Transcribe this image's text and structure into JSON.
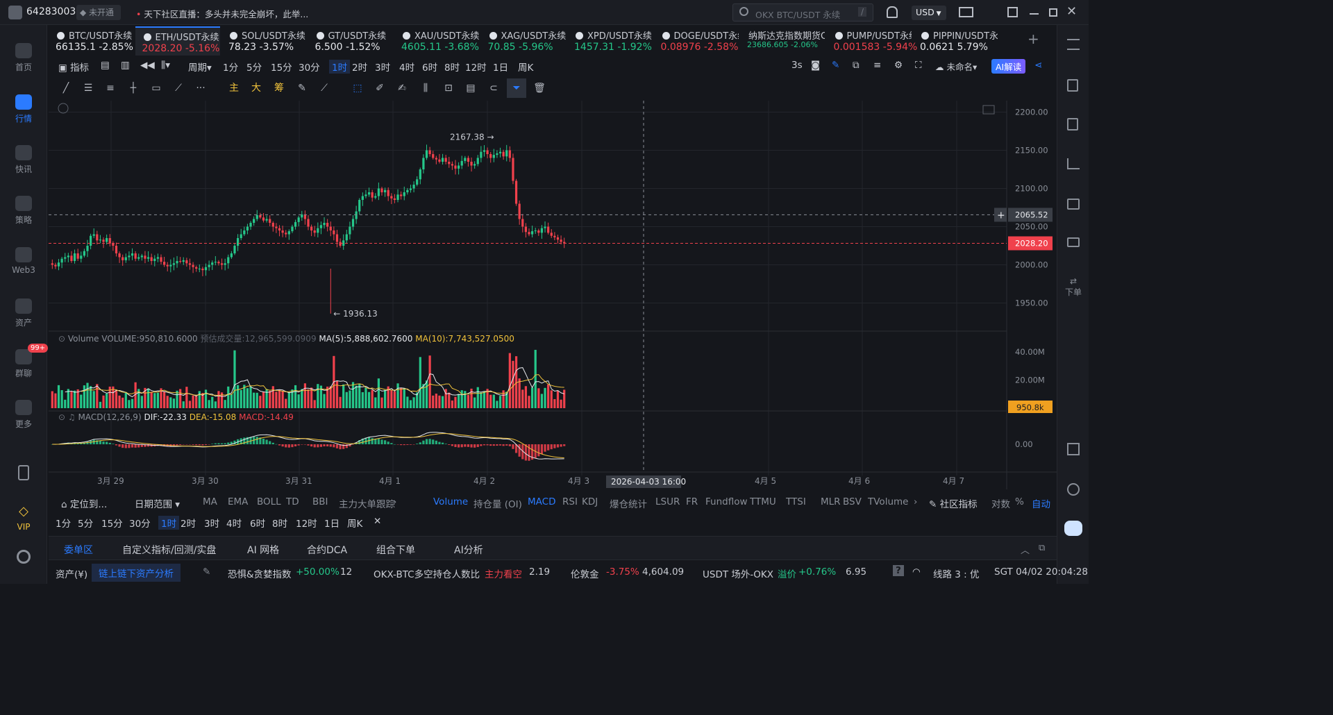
{
  "topbar": {
    "user_id": "64283003",
    "market_status": "未开通",
    "news": "天下社区直播：多头并未完全崩坏，此举...",
    "search_placeholder": "OKX BTC/USDT 永续",
    "search_shortcut": "/",
    "currency": "USD"
  },
  "nav": [
    {
      "label": "首页",
      "icon": "home-icon"
    },
    {
      "label": "行情",
      "icon": "market-icon",
      "active": true
    },
    {
      "label": "快讯",
      "icon": "news-icon"
    },
    {
      "label": "策略",
      "icon": "robot-icon"
    },
    {
      "label": "Web3",
      "icon": "web3-icon"
    },
    {
      "label": "资产",
      "icon": "wallet-icon"
    },
    {
      "label": "群聊",
      "icon": "chat-icon",
      "badge": "99+"
    },
    {
      "label": "更多",
      "icon": "grid-icon"
    },
    {
      "label": "",
      "icon": "phone-icon"
    },
    {
      "label": "VIP",
      "icon": "vip-icon"
    },
    {
      "label": "",
      "icon": "settings-icon"
    }
  ],
  "tickers": [
    {
      "name": "BTC/USDT永续",
      "price": "66135.1",
      "change": "-2.85%",
      "dir": "white"
    },
    {
      "name": "ETH/USDT永续",
      "price": "2028.20",
      "change": "-5.16%",
      "dir": "down",
      "active": true
    },
    {
      "name": "SOL/USDT永续",
      "price": "78.23",
      "change": "-3.57%",
      "dir": "white"
    },
    {
      "name": "GT/USDT永续",
      "price": "6.500",
      "change": "-1.52%",
      "dir": "white"
    },
    {
      "name": "XAU/USDT永续",
      "price": "4605.11",
      "change": "-3.68%",
      "dir": "up"
    },
    {
      "name": "XAG/USDT永续",
      "price": "70.85",
      "change": "-5.96%",
      "dir": "up"
    },
    {
      "name": "XPD/USDT永续",
      "price": "1457.31",
      "change": "-1.92%",
      "dir": "up"
    },
    {
      "name": "DOGE/USDT永续",
      "price": "0.08976",
      "change": "-2.58%",
      "dir": "down"
    },
    {
      "name": "纳斯达克指数期货C",
      "price": "23686.605",
      "change": "-2.06%",
      "dir": "up",
      "small": true
    },
    {
      "name": "PUMP/USDT永续",
      "price": "0.001583",
      "change": "-5.94%",
      "dir": "down"
    },
    {
      "name": "PIPPIN/USDT永续",
      "price": "0.0621",
      "change": "5.79%",
      "dir": "white"
    }
  ],
  "periodbar": {
    "indicator": "指标",
    "period": "周期",
    "periods": [
      "1分",
      "5分",
      "15分",
      "30分",
      "1时",
      "2时",
      "3时",
      "4时",
      "6时",
      "8时",
      "12时",
      "1日",
      "周K"
    ],
    "selected": "1时",
    "refresh": "3s",
    "unnamed": "未命名",
    "ai": "AI解读"
  },
  "toolbar_labels": [
    "主",
    "大",
    "筹"
  ],
  "chart_data": {
    "type": "candlestick",
    "symbol": "ETH/USDT永续",
    "interval": "1时",
    "y_ticks": [
      "2200.00",
      "2150.00",
      "2100.00",
      "2050.00",
      "2000.00",
      "1950.00"
    ],
    "ylim": [
      1915,
      2215
    ],
    "x_ticks": [
      "3月 29",
      "3月 30",
      "3月 31",
      "4月 1",
      "4月 2",
      "4月 3",
      "4月 5",
      "4月 6",
      "4月 7"
    ],
    "high_label": "2167.38",
    "low_label": "1936.13",
    "last_price": "2028.20",
    "crosshair_price": "2065.52",
    "crosshair_time": "2026-04-03 16:00",
    "close_series": [
      2000,
      1998,
      2003,
      2008,
      2010,
      2012,
      2005,
      2015,
      2008,
      2012,
      2018,
      2025,
      2038,
      2040,
      2032,
      2033,
      2030,
      2035,
      2028,
      2025,
      2015,
      2010,
      2006,
      2010,
      2012,
      2015,
      2008,
      2010,
      2012,
      2008,
      2010,
      2005,
      2008,
      2010,
      2004,
      2000,
      1998,
      2000,
      2002,
      2005,
      2004,
      2006,
      2002,
      2000,
      1997,
      1995,
      1995,
      1993,
      1997,
      2000,
      2003,
      2004,
      2002,
      2000,
      2002,
      2010,
      2015,
      2025,
      2035,
      2040,
      2045,
      2050,
      2055,
      2060,
      2065,
      2062,
      2058,
      2060,
      2055,
      2050,
      2048,
      2045,
      2042,
      2040,
      2044,
      2050,
      2056,
      2062,
      2066,
      2060,
      2050,
      2045,
      2042,
      2048,
      2052,
      2055,
      2050,
      2045,
      2040,
      2030,
      2025,
      2032,
      2040,
      2050,
      2060,
      2070,
      2085,
      2090,
      2092,
      2095,
      2088,
      2090,
      2100,
      2095,
      2098,
      2090,
      2087,
      2085,
      2092,
      2090,
      2095,
      2098,
      2100,
      2105,
      2112,
      2125,
      2140,
      2150,
      2145,
      2140,
      2138,
      2135,
      2140,
      2135,
      2132,
      2130,
      2126,
      2130,
      2136,
      2140,
      2135,
      2130,
      2132,
      2140,
      2148,
      2150,
      2145,
      2140,
      2144,
      2146,
      2148,
      2142,
      2150,
      2140,
      2110,
      2080,
      2060,
      2050,
      2043,
      2040,
      2044,
      2045,
      2042,
      2048,
      2050,
      2042,
      2038,
      2036,
      2033,
      2030,
      2028
    ],
    "volume": {
      "label": "Volume",
      "volume_value": "VOLUME:950,810.6000",
      "estimated": "预估成交量:12,965,599.0909",
      "ma5": "MA(5):5,888,602.7600",
      "ma10": "MA(10):7,743,527.0500",
      "y_ticks": [
        "40.00M",
        "20.00M"
      ],
      "last": "950.8k"
    },
    "macd": {
      "label": "MACD(12,26,9)",
      "dif": "DIF:-22.33",
      "dea": "DEA:-15.08",
      "macd": "MACD:-14.49",
      "y_ticks": [
        "0.00"
      ]
    }
  },
  "indicator_row": {
    "locate": "定位到...",
    "date_range": "日期范围",
    "main": [
      "MA",
      "EMA",
      "BOLL",
      "TD",
      "BBI",
      "主力大单跟踪"
    ],
    "sub": [
      "Volume",
      "持仓量 (OI)",
      "MACD",
      "RSI",
      "KDJ",
      "爆仓统计",
      "LSUR",
      "FR",
      "Fundflow",
      "TTMU",
      "TTSI",
      "MLR",
      "BSV",
      "TVolume"
    ],
    "community": "社区指标",
    "log": "对数",
    "percent": "%",
    "auto": "自动"
  },
  "periods2": [
    "1分",
    "5分",
    "15分",
    "30分",
    "1时",
    "2时",
    "3时",
    "4时",
    "6时",
    "8时",
    "12时",
    "1日",
    "周K"
  ],
  "bottom_tabs": [
    "委单区",
    "自定义指标/回测/实盘",
    "AI 网格",
    "合约DCA",
    "组合下单",
    "AI分析"
  ],
  "statusbar": {
    "assets": "资产(¥)",
    "onchain": "链上链下资产分析",
    "fear_greed_label": "恐惧&贪婪指数",
    "fear_greed_change": "+50.00%",
    "fear_greed_value": "12",
    "ratio_label": "OKX-BTC多空持仓人数比",
    "ratio_status": "主力看空",
    "ratio_value": "2.19",
    "gold_label": "伦敦金",
    "gold_change": "-3.75%",
    "gold_value": "4,604.09",
    "usdt_label": "USDT 场外-OKX",
    "premium_label": "溢价",
    "premium_change": "+0.76%",
    "premium_value": "6.95",
    "line": "线路 3 : 优",
    "time": "SGT 04/02 20:04:28"
  },
  "colors": {
    "up": "#25c78a",
    "down": "#f0414c",
    "accent": "#2b7bff",
    "yellow": "#f0c23b"
  }
}
